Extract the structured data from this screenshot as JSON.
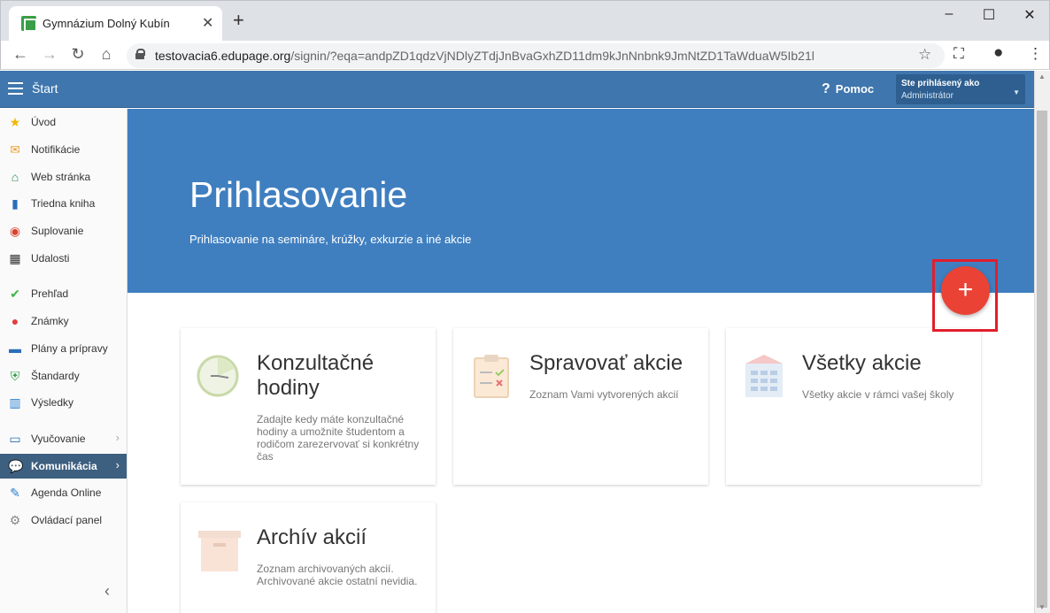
{
  "browser": {
    "tab_title": "Gymnázium Dolný Kubín",
    "tab_close": "✕",
    "new_tab": "+",
    "url_host": "testovacia6.edupage.org",
    "url_path": "/signin/?eqa=andpZD1qdzVjNDlyZTdjJnBvaGxhZD11dm9kJnNnbnk9JmNtZD1TaWduaW5Ib21l",
    "controls": {
      "minimize": "–",
      "maximize": "☐",
      "close": "✕"
    }
  },
  "header": {
    "start_label": "Štart",
    "help_label": "Pomoc",
    "user_line1": "Ste prihlásený ako",
    "user_line2": "Administrátor"
  },
  "sidebar": {
    "items": [
      {
        "label": "Úvod",
        "icon": "star-icon"
      },
      {
        "label": "Notifikácie",
        "icon": "envelope-icon"
      },
      {
        "label": "Web stránka",
        "icon": "home-icon"
      },
      {
        "label": "Triedna kniha",
        "icon": "book-icon"
      },
      {
        "label": "Suplovanie",
        "icon": "substitute-icon"
      },
      {
        "label": "Udalosti",
        "icon": "calendar-icon"
      },
      {
        "label": "Prehľad",
        "icon": "check-icon"
      },
      {
        "label": "Známky",
        "icon": "grades-icon"
      },
      {
        "label": "Plány a prípravy",
        "icon": "briefcase-icon"
      },
      {
        "label": "Štandardy",
        "icon": "shield-icon"
      },
      {
        "label": "Výsledky",
        "icon": "barchart-icon"
      },
      {
        "label": "Vyučovanie",
        "icon": "open-book-icon"
      },
      {
        "label": "Komunikácia",
        "icon": "chat-icon"
      },
      {
        "label": "Agenda Online",
        "icon": "pen-icon"
      },
      {
        "label": "Ovládací panel",
        "icon": "gear-icon"
      }
    ],
    "active_item": "Komunikácia"
  },
  "hero": {
    "title": "Prihlasovanie",
    "subtitle": "Prihlasovanie na semináre, krúžky, exkurzie a iné akcie",
    "fab_label": "+"
  },
  "cards": [
    {
      "title": "Konzultačné hodiny",
      "description": "Zadajte kedy máte konzultačné hodiny a umožnite študentom a rodičom zarezervovať si konkrétny čas",
      "icon": "clock-icon"
    },
    {
      "title": "Spravovať akcie",
      "description": "Zoznam Vami vytvorených akcií",
      "icon": "clipboard-icon"
    },
    {
      "title": "Všetky akcie",
      "description": "Všetky akcie v rámci vašej školy",
      "icon": "building-icon"
    },
    {
      "title": "Archív akcií",
      "description": "Zoznam archivovaných akcií. Archivované akcie ostatní nevidia.",
      "icon": "archive-box-icon"
    }
  ],
  "colors": {
    "header": "#3f76ad",
    "hero": "#3f7fc0",
    "fab": "#ea4335",
    "highlight_frame": "#e11f2b",
    "sidebar_active": "#3d5f80"
  }
}
